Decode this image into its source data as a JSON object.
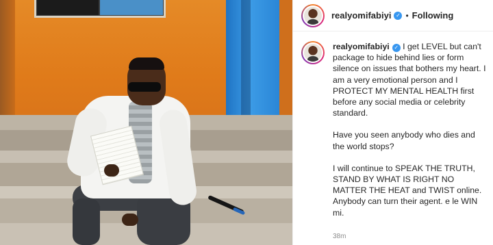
{
  "post": {
    "header": {
      "username": "realyomifabiyi",
      "separator": "•",
      "follow_state": "Following"
    },
    "caption": {
      "username": "realyomifabiyi",
      "paragraphs": [
        "I get LEVEL but can't package to hide behind lies or form silence on issues that bothers my heart. I am a very emotional person and I PROTECT MY MENTAL HEALTH first before any social media or celebrity standard.",
        "Have you seen anybody who dies and the world stops?",
        "I will continue to SPEAK THE TRUTH, STAND BY WHAT IS RIGHT NO MATTER THE HEAT and TWIST online. Anybody can turn their agent. e le WIN mi."
      ],
      "timestamp": "38m"
    }
  },
  "icons": {
    "verified": "verified-badge-icon",
    "avatar_ring": "story-ring"
  },
  "colors": {
    "verified_blue": "#3897f0",
    "text": "#262626",
    "muted": "#8e8e8e"
  }
}
